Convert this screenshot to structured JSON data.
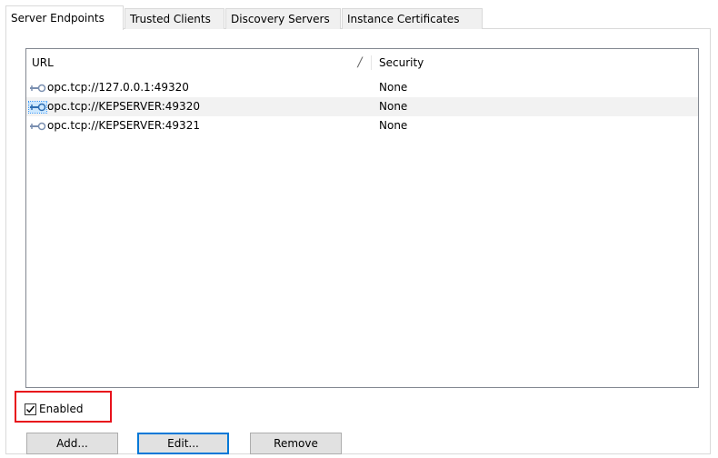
{
  "tabs": [
    {
      "label": "Server Endpoints",
      "active": true
    },
    {
      "label": "Trusted Clients",
      "active": false
    },
    {
      "label": "Discovery Servers",
      "active": false
    },
    {
      "label": "Instance Certificates",
      "active": false
    }
  ],
  "list": {
    "columns": {
      "url": "URL",
      "sort_glyph": "/",
      "security": "Security"
    },
    "rows": [
      {
        "url": "opc.tcp://127.0.0.1:49320",
        "security": "None",
        "icon": "endpoint-plug-icon",
        "selected": false
      },
      {
        "url": "opc.tcp://KEPSERVER:49320",
        "security": "None",
        "icon": "endpoint-plug-icon",
        "selected": true
      },
      {
        "url": "opc.tcp://KEPSERVER:49321",
        "security": "None",
        "icon": "endpoint-plug-icon",
        "selected": false
      }
    ]
  },
  "enabled": {
    "label": "Enabled",
    "checked": true
  },
  "buttons": {
    "add": "Add...",
    "edit": "Edit...",
    "remove": "Remove"
  },
  "colors": {
    "highlight": "#e8121b",
    "focus": "#0078d7",
    "selection": "#f2f2f2"
  }
}
